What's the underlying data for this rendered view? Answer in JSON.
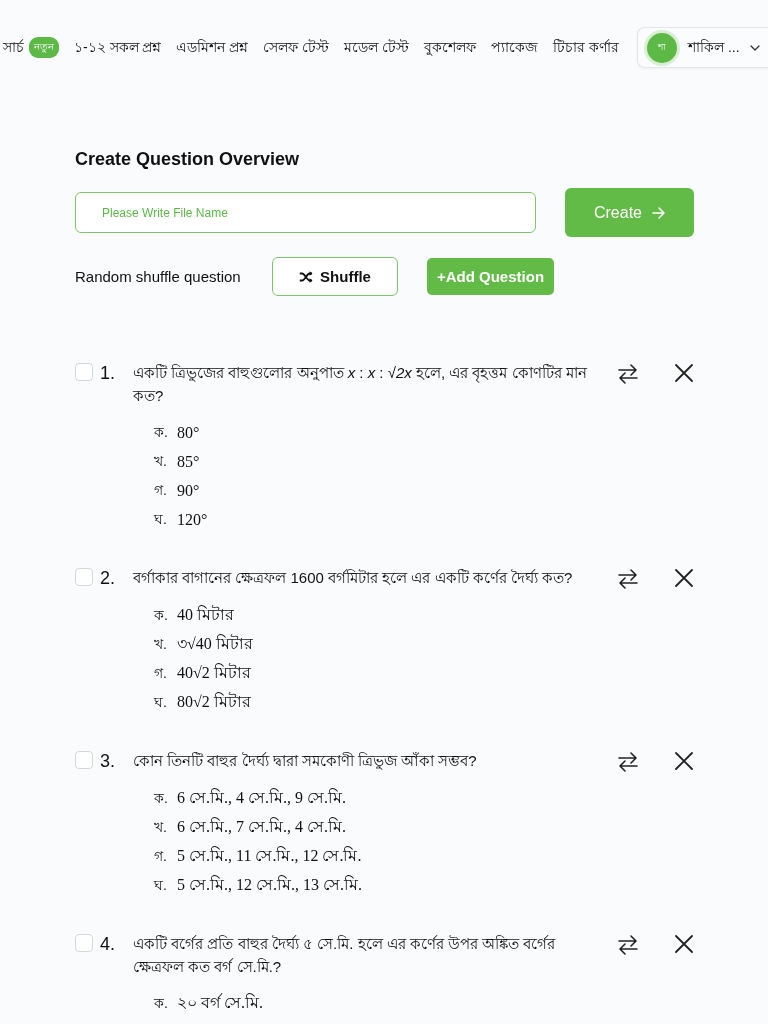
{
  "nav": {
    "items": [
      {
        "label": "সার্চ",
        "badge": "নতুন"
      },
      {
        "label": "১-১২ সকল প্রশ্ন"
      },
      {
        "label": "এডমিশন প্রশ্ন"
      },
      {
        "label": "সেলফ টেস্ট"
      },
      {
        "label": "মডেল টেস্ট"
      },
      {
        "label": "বুকশেলফ"
      },
      {
        "label": "প্যাকেজ"
      },
      {
        "label": "টিচার কর্ণার"
      }
    ],
    "user": {
      "avatar": "শা",
      "name": "শাকিল ..."
    }
  },
  "header": {
    "title": "Create Question Overview",
    "file_name": {
      "placeholder": "Please Write File Name"
    },
    "create_button": "Create",
    "shuffle_label": "Random shuffle question",
    "shuffle_button": "Shuffle",
    "add_button": "+Add Question"
  },
  "questions": [
    {
      "number": "1.",
      "checked": false,
      "text": "একটি ত্রিভুজের বাহুগুলোর অনুপাত *x* : *x* : *√2x* হলে, এর বৃহত্তম কোণটির মান কত?",
      "options": [
        {
          "label": "ক.",
          "text": "80°"
        },
        {
          "label": "খ.",
          "text": "85°"
        },
        {
          "label": "গ.",
          "text": "90°"
        },
        {
          "label": "ঘ.",
          "text": "120°"
        }
      ]
    },
    {
      "number": "2.",
      "checked": false,
      "text": "বর্গাকার বাগানের ক্ষেত্রফল 1600 বর্গমিটার হলে এর একটি কর্ণের দৈর্ঘ্য কত?",
      "options": [
        {
          "label": "ক.",
          "text": "40 মিটার"
        },
        {
          "label": "খ.",
          "text": "৩√40 মিটার"
        },
        {
          "label": "গ.",
          "text": "40√2 মিটার"
        },
        {
          "label": "ঘ.",
          "text": "80√2 মিটার"
        }
      ]
    },
    {
      "number": "3.",
      "checked": false,
      "text": "কোন তিনটি বাহুর দৈর্ঘ্য দ্বারা সমকোণী ত্রিভুজ আঁকা সম্ভব?",
      "options": [
        {
          "label": "ক.",
          "text": "6 সে.মি., 4 সে.মি., 9 সে.মি."
        },
        {
          "label": "খ.",
          "text": "6 সে.মি., 7 সে.মি., 4 সে.মি."
        },
        {
          "label": "গ.",
          "text": "5 সে.মি., 11 সে.মি., 12 সে.মি."
        },
        {
          "label": "ঘ.",
          "text": "5 সে.মি., 12 সে.মি., 13 সে.মি."
        }
      ]
    },
    {
      "number": "4.",
      "checked": false,
      "text": "একটি বর্গের প্রতি বাহুর দৈর্ঘ্য ৫ সে.মি. হলে এর কর্ণের উপর অঙ্কিত বর্গের ক্ষেত্রফল কত বর্গ সে.মি.?",
      "options": [
        {
          "label": "ক.",
          "text": "২০ বর্গ সে.মি."
        }
      ]
    }
  ]
}
